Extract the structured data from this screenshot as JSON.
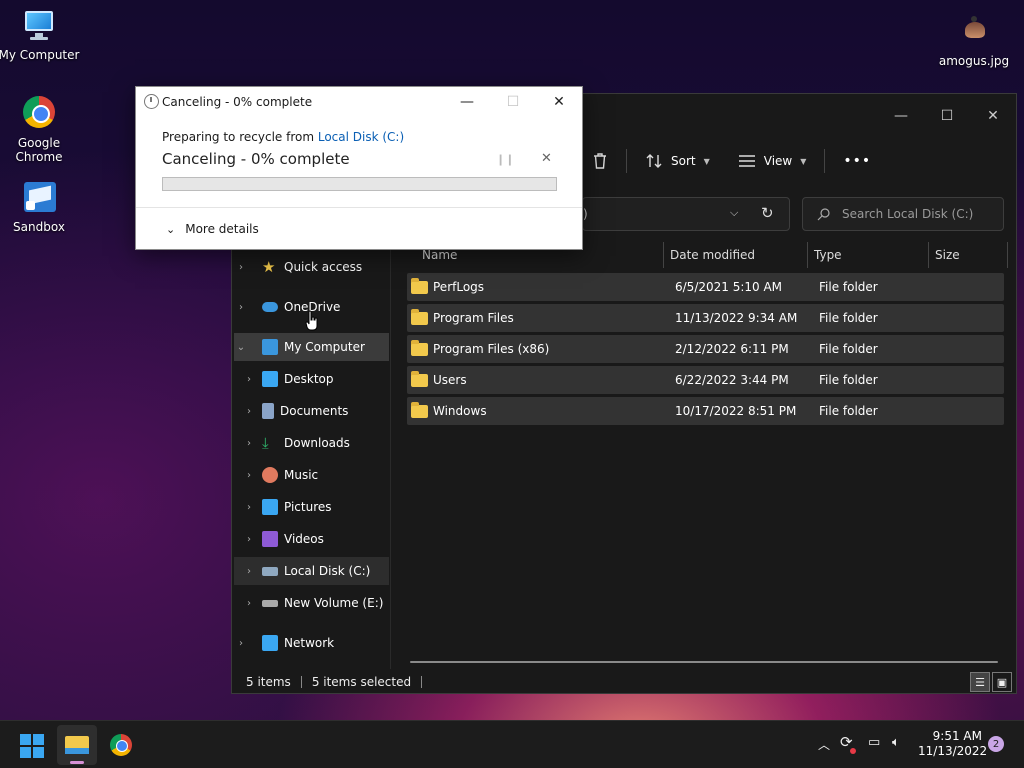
{
  "desktop": {
    "icons": [
      {
        "label": "My Computer",
        "icon": "computer-icon"
      },
      {
        "label": "Google Chrome",
        "icon": "chrome-icon"
      },
      {
        "label": "Sandbox",
        "icon": "sandbox-icon"
      },
      {
        "label": "amogus.jpg",
        "icon": "image-file-icon"
      }
    ]
  },
  "explorer": {
    "toolbar": {
      "sort_label": "Sort",
      "view_label": "View",
      "more_label": "•••"
    },
    "address": {
      "partial_text": ")"
    },
    "search": {
      "placeholder": "Search Local Disk (C:)"
    },
    "nav": [
      {
        "label": "Quick access",
        "icon": "star-icon",
        "color": "#f2c94c"
      },
      {
        "label": "OneDrive",
        "icon": "cloud-icon",
        "color": "#3a96dd"
      },
      {
        "label": "My Computer",
        "icon": "computer-icon",
        "color": "#3a96dd"
      },
      {
        "label": "Desktop",
        "icon": "desktop-icon",
        "color": "#3aa7f2"
      },
      {
        "label": "Documents",
        "icon": "document-icon",
        "color": "#8aa4c8"
      },
      {
        "label": "Downloads",
        "icon": "download-icon",
        "color": "#2fb36b"
      },
      {
        "label": "Music",
        "icon": "music-icon",
        "color": "#e07a5f"
      },
      {
        "label": "Pictures",
        "icon": "picture-icon",
        "color": "#3aa7f2"
      },
      {
        "label": "Videos",
        "icon": "video-icon",
        "color": "#8e5ad6"
      },
      {
        "label": "Local Disk (C:)",
        "icon": "drive-icon",
        "color": "#8fa8c0"
      },
      {
        "label": "New Volume (E:)",
        "icon": "drive-icon",
        "color": "#aaaaaa"
      },
      {
        "label": "Network",
        "icon": "network-icon",
        "color": "#3aa7f2"
      }
    ],
    "columns": {
      "name": "Name",
      "date": "Date modified",
      "type": "Type",
      "size": "Size"
    },
    "files": [
      {
        "name": "PerfLogs",
        "date": "6/5/2021 5:10 AM",
        "type": "File folder"
      },
      {
        "name": "Program Files",
        "date": "11/13/2022 9:34 AM",
        "type": "File folder"
      },
      {
        "name": "Program Files (x86)",
        "date": "2/12/2022 6:11 PM",
        "type": "File folder"
      },
      {
        "name": "Users",
        "date": "6/22/2022 3:44 PM",
        "type": "File folder"
      },
      {
        "name": "Windows",
        "date": "10/17/2022 8:51 PM",
        "type": "File folder"
      }
    ],
    "status": {
      "items": "5 items",
      "selected": "5 items selected"
    }
  },
  "dialog": {
    "title": "Canceling - 0% complete",
    "line1_prefix": "Preparing to recycle from ",
    "line1_link": "Local Disk (C:)",
    "status": "Canceling - 0% complete",
    "progress_percent": 0,
    "more_details": "More details"
  },
  "taskbar": {
    "time": "9:51 AM",
    "date": "11/13/2022",
    "notifications": "2"
  }
}
